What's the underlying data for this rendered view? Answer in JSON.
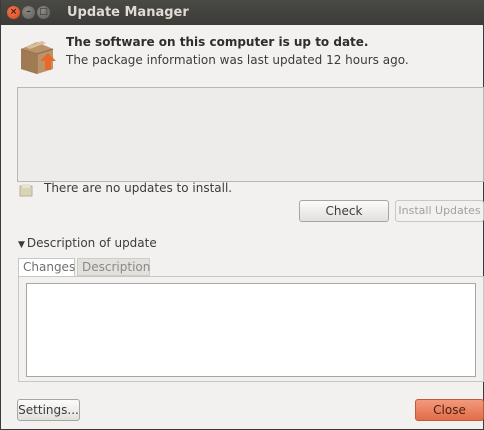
{
  "window": {
    "title": "Update Manager",
    "close_glyph": "×",
    "min_glyph": "–",
    "max_glyph": "□"
  },
  "status": {
    "headline": "The software on this computer is up to date.",
    "subline": "The package information was last updated 12 hours ago.",
    "no_updates": "There are no updates to install."
  },
  "buttons": {
    "check": "Check",
    "install": "Install Updates",
    "settings": "Settings...",
    "close": "Close"
  },
  "description": {
    "toggle_label": "Description of update",
    "tabs": [
      "Changes",
      "Description"
    ]
  },
  "icons": {
    "package": "package-box-icon",
    "status": "update-status-icon"
  },
  "colors": {
    "titlebar": "#3c3b37",
    "close_accent": "#e26c48",
    "window_bg": "#f2f1f0"
  }
}
